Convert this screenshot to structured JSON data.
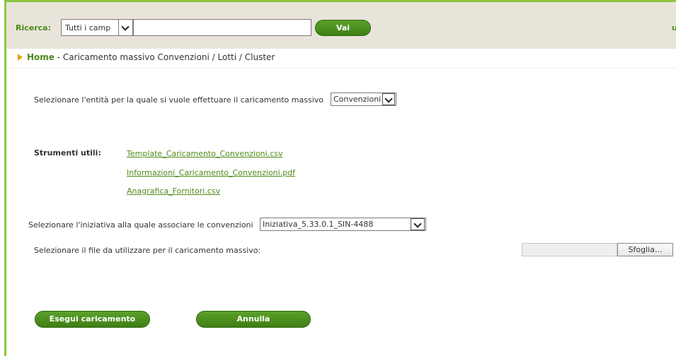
{
  "search": {
    "label": "Ricerca:",
    "field_select_value": "Tutti i camp",
    "input_value": "",
    "go_label": "Vai",
    "right_text": "un"
  },
  "breadcrumb": {
    "home": "Home",
    "separator": " - ",
    "current": "Caricamento massivo Convenzioni / Lotti / Cluster"
  },
  "entity": {
    "label": "Selezionare l'entità per la quale si vuole effettuare il caricamento massivo",
    "selected": "Convenzioni"
  },
  "tools": {
    "label": "Strumenti utili:",
    "links": [
      "Template_Caricamento_Convenzioni.csv",
      "Informazioni_Caricamento_Convenzioni.pdf",
      "Anagrafica_Fornitori.csv"
    ]
  },
  "initiative": {
    "label": "Selezionare l'iniziativa alla quale associare le convenzioni",
    "selected": "Iniziativa_5.33.0.1_SIN-4488"
  },
  "file": {
    "label": "Selezionare il file da utilizzare per il caricamento massivo:",
    "path_value": "",
    "browse_label": "Sfoglia..."
  },
  "actions": {
    "execute_label": "Esegui caricamento",
    "cancel_label": "Annulla"
  },
  "colors": {
    "accent": "#4e8a1a",
    "button": "#4a8f1e",
    "frame": "#8dc63f",
    "header_bg": "#e8e4da",
    "breadcrumb_arrow": "#e8a013"
  }
}
